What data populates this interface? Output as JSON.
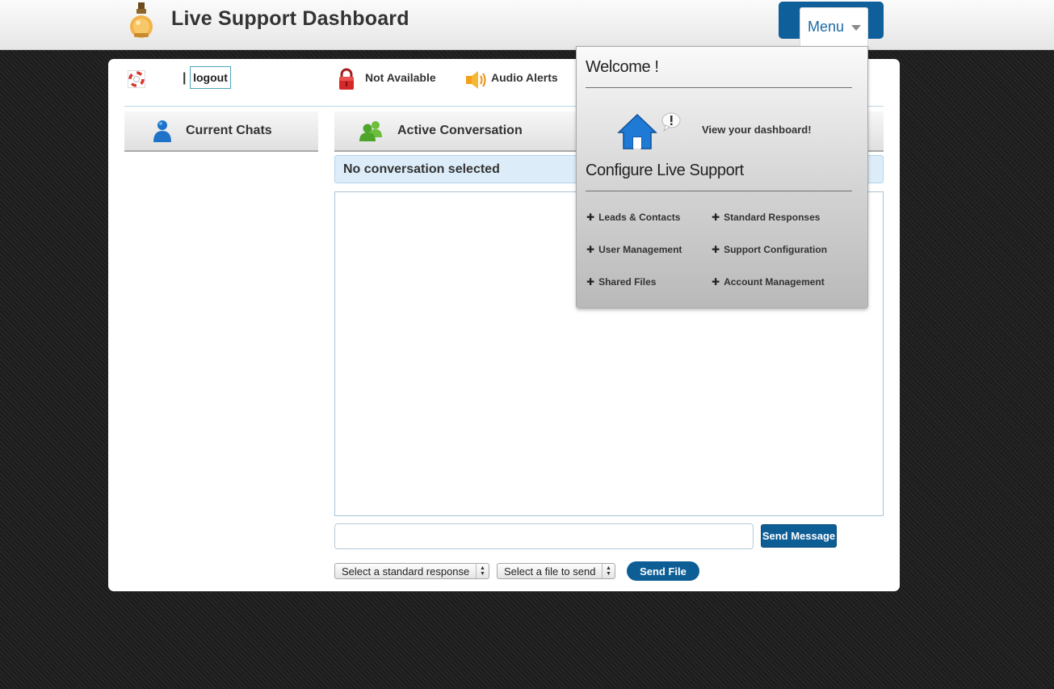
{
  "header": {
    "title": "Live Support Dashboard",
    "logo_icon": "lightbulb-icon",
    "menu_label": "Menu"
  },
  "status_bar": {
    "separator": "|",
    "logout_label": "logout",
    "availability": "Not Available",
    "audio": "Audio Alerts"
  },
  "panels": {
    "current_chats": "Current Chats",
    "active_conversation": "Active Conversation",
    "no_conversation": "No conversation selected"
  },
  "composer": {
    "message_placeholder": "",
    "send_message_label": "Send Message",
    "standard_response_select": "Select a standard response",
    "file_select": "Select a file to send",
    "send_file_label": "Send File"
  },
  "menu_dropdown": {
    "welcome": "Welcome !",
    "dashboard_link": "View your dashboard!",
    "configure_heading": "Configure Live Support",
    "items": [
      {
        "label": "Leads & Contacts"
      },
      {
        "label": "Standard Responses"
      },
      {
        "label": "User Management"
      },
      {
        "label": "Support Configuration"
      },
      {
        "label": "Shared Files"
      },
      {
        "label": "Account Management"
      }
    ]
  },
  "colors": {
    "accent": "#0f5f9a",
    "info_bg": "#dcedf9",
    "background": "#1f1f1f"
  }
}
